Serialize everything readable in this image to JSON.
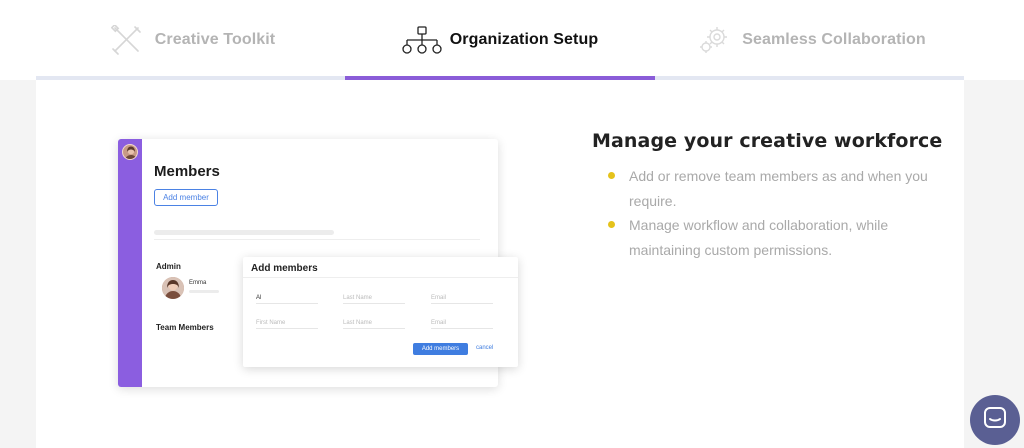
{
  "tabs": [
    {
      "label": "Creative Toolkit",
      "icon": "crossed-tools-icon",
      "active": false
    },
    {
      "label": "Organization Setup",
      "icon": "org-chart-icon",
      "active": true
    },
    {
      "label": "Seamless Collaboration",
      "icon": "gears-icon",
      "active": false
    }
  ],
  "colors": {
    "accent": "#8a5cd8",
    "bullet": "#e5c21b",
    "button_blue": "#3f7de0",
    "chat": "#5a5f93"
  },
  "mockup": {
    "title": "Members",
    "add_button": "Add member",
    "admin_label": "Admin",
    "admin_member": "Emma",
    "team_label": "Team Members",
    "modal": {
      "title": "Add members",
      "row1": {
        "first": "Al",
        "last": "Last Name",
        "email": "Email"
      },
      "row2": {
        "first": "First Name",
        "last": "Last Name",
        "email": "Email"
      },
      "submit": "Add members",
      "cancel": "cancel"
    }
  },
  "content": {
    "heading": "Manage your creative workforce",
    "bullets": [
      "Add or remove team members as and when you require.",
      "Manage workflow and collaboration, while maintaining custom permissions."
    ]
  },
  "chat": {
    "icon": "chat-bubble-icon"
  }
}
